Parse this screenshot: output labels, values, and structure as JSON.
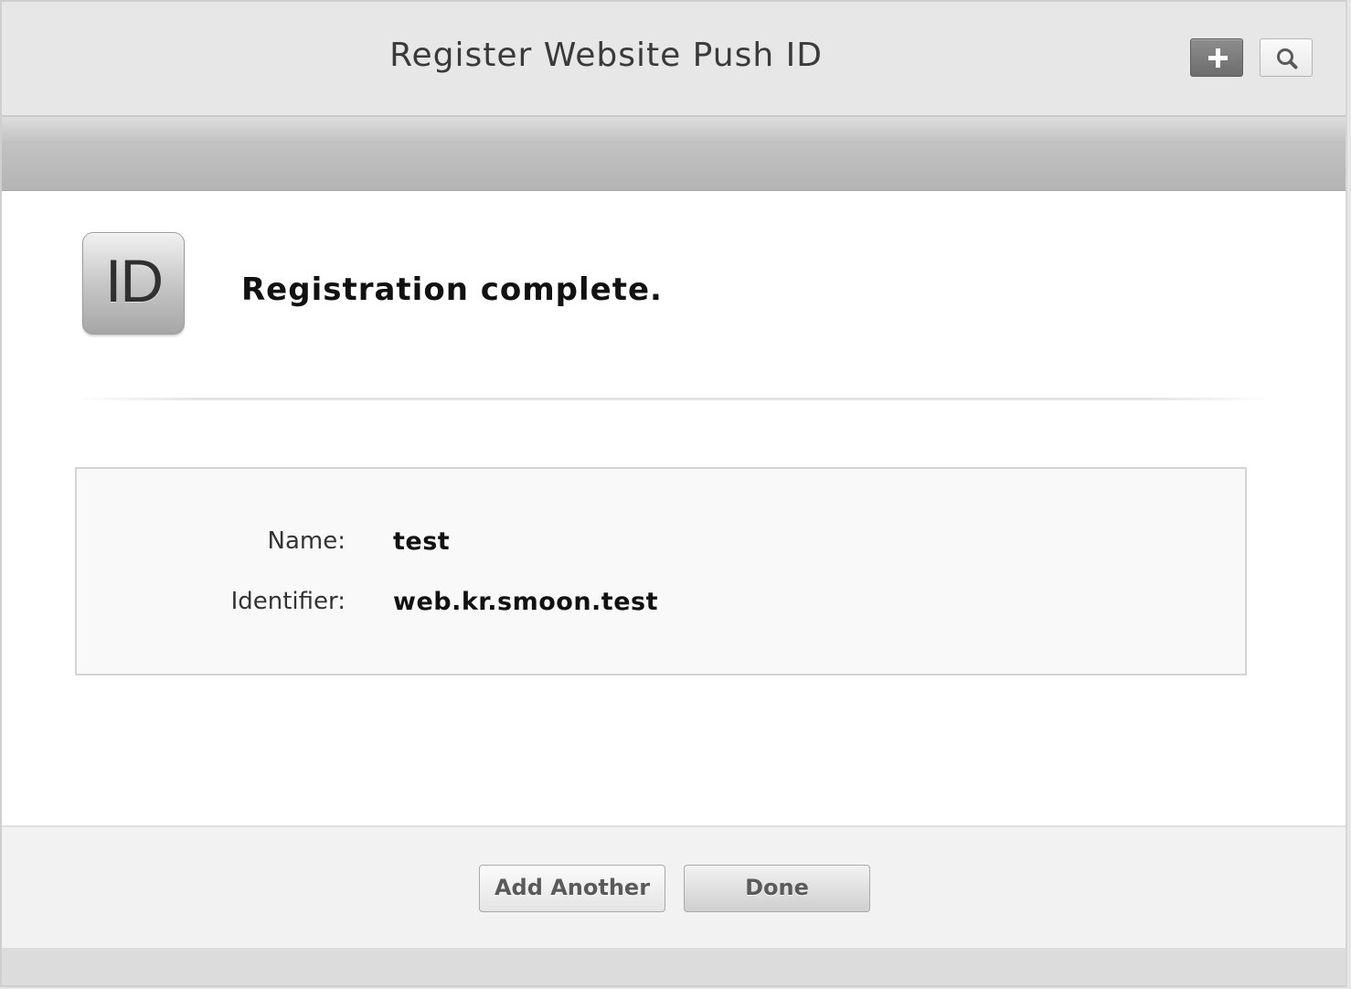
{
  "window": {
    "title": "Register Website Push ID"
  },
  "toolbar": {
    "add_icon": "plus-icon",
    "search_icon": "search-icon"
  },
  "header": {
    "icon_text": "ID",
    "status": "Registration complete."
  },
  "details": {
    "rows": [
      {
        "label": "Name:",
        "value": "test"
      },
      {
        "label": "Identifier:",
        "value": "web.kr.smoon.test"
      }
    ]
  },
  "footer": {
    "add_another_label": "Add Another",
    "done_label": "Done"
  },
  "colors": {
    "titlebar_bg": "#e7e7e7",
    "subbar_bg": "#b4b4b4",
    "info_box_bg": "#f8f9f8",
    "footer_bg": "#f2f2f2"
  }
}
